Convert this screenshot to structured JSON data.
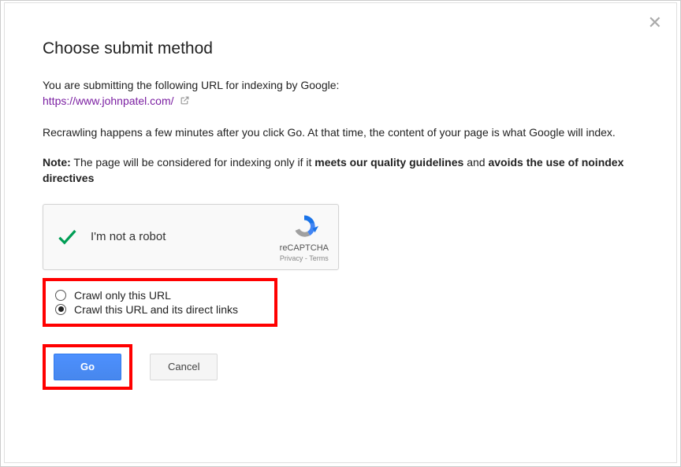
{
  "title": "Choose submit method",
  "intro": {
    "line1": "You are submitting the following URL for indexing by Google:",
    "url": "https://www.johnpatel.com/"
  },
  "recrawl_note": "Recrawling happens a few minutes after you click Go. At that time, the content of your page is what Google will index.",
  "note": {
    "prefix": "Note:",
    "text1": " The page will be considered for indexing only if it ",
    "strong1": "meets our quality guidelines",
    "text2": " and ",
    "strong2": "avoids the use of noindex directives"
  },
  "recaptcha": {
    "label": "I'm not a robot",
    "brand": "reCAPTCHA",
    "privacy": "Privacy",
    "sep": " - ",
    "terms": "Terms"
  },
  "options": {
    "opt1": "Crawl only this URL",
    "opt2": "Crawl this URL and its direct links"
  },
  "buttons": {
    "go": "Go",
    "cancel": "Cancel"
  }
}
